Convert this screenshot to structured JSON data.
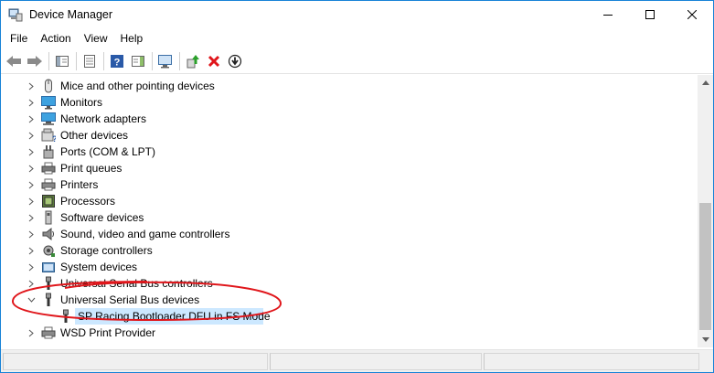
{
  "window": {
    "title": "Device Manager"
  },
  "menu": [
    {
      "label": "File"
    },
    {
      "label": "Action"
    },
    {
      "label": "View"
    },
    {
      "label": "Help"
    }
  ],
  "toolbar": [
    {
      "icon": "back-arrow-icon"
    },
    {
      "icon": "forward-arrow-icon"
    },
    {
      "icon": "show-hide-console-tree-icon"
    },
    {
      "icon": "properties-icon"
    },
    {
      "icon": "help-icon"
    },
    {
      "icon": "action-pane-icon"
    },
    {
      "icon": "scan-hardware-icon"
    },
    {
      "icon": "update-driver-icon"
    },
    {
      "icon": "uninstall-device-icon"
    },
    {
      "icon": "disable-device-icon"
    }
  ],
  "tree": {
    "items": [
      {
        "label": "Mice and other pointing devices",
        "icon": "mouse-icon",
        "expanded": false
      },
      {
        "label": "Monitors",
        "icon": "monitor-icon",
        "expanded": false
      },
      {
        "label": "Network adapters",
        "icon": "network-adapter-icon",
        "expanded": false
      },
      {
        "label": "Other devices",
        "icon": "other-devices-icon",
        "expanded": false
      },
      {
        "label": "Ports (COM & LPT)",
        "icon": "port-icon",
        "expanded": false
      },
      {
        "label": "Print queues",
        "icon": "print-queue-icon",
        "expanded": false
      },
      {
        "label": "Printers",
        "icon": "printer-icon",
        "expanded": false
      },
      {
        "label": "Processors",
        "icon": "processor-icon",
        "expanded": false
      },
      {
        "label": "Software devices",
        "icon": "software-device-icon",
        "expanded": false
      },
      {
        "label": "Sound, video and game controllers",
        "icon": "speaker-icon",
        "expanded": false
      },
      {
        "label": "Storage controllers",
        "icon": "storage-controller-icon",
        "expanded": false
      },
      {
        "label": "System devices",
        "icon": "system-device-icon",
        "expanded": false
      },
      {
        "label": "Universal Serial Bus controllers",
        "icon": "usb-icon",
        "expanded": false
      },
      {
        "label": "Universal Serial Bus devices",
        "icon": "usb-icon",
        "expanded": true
      },
      {
        "label": "SP Racing Bootloader DFU in FS Mode",
        "icon": "usb-device-icon",
        "child": true,
        "selected": true
      },
      {
        "label": "WSD Print Provider",
        "icon": "wsd-printer-icon",
        "expanded": false
      }
    ]
  },
  "colors": {
    "annotation": "#e0161b",
    "selection": "#cce8ff",
    "titlebar_border": "#1883d7"
  }
}
